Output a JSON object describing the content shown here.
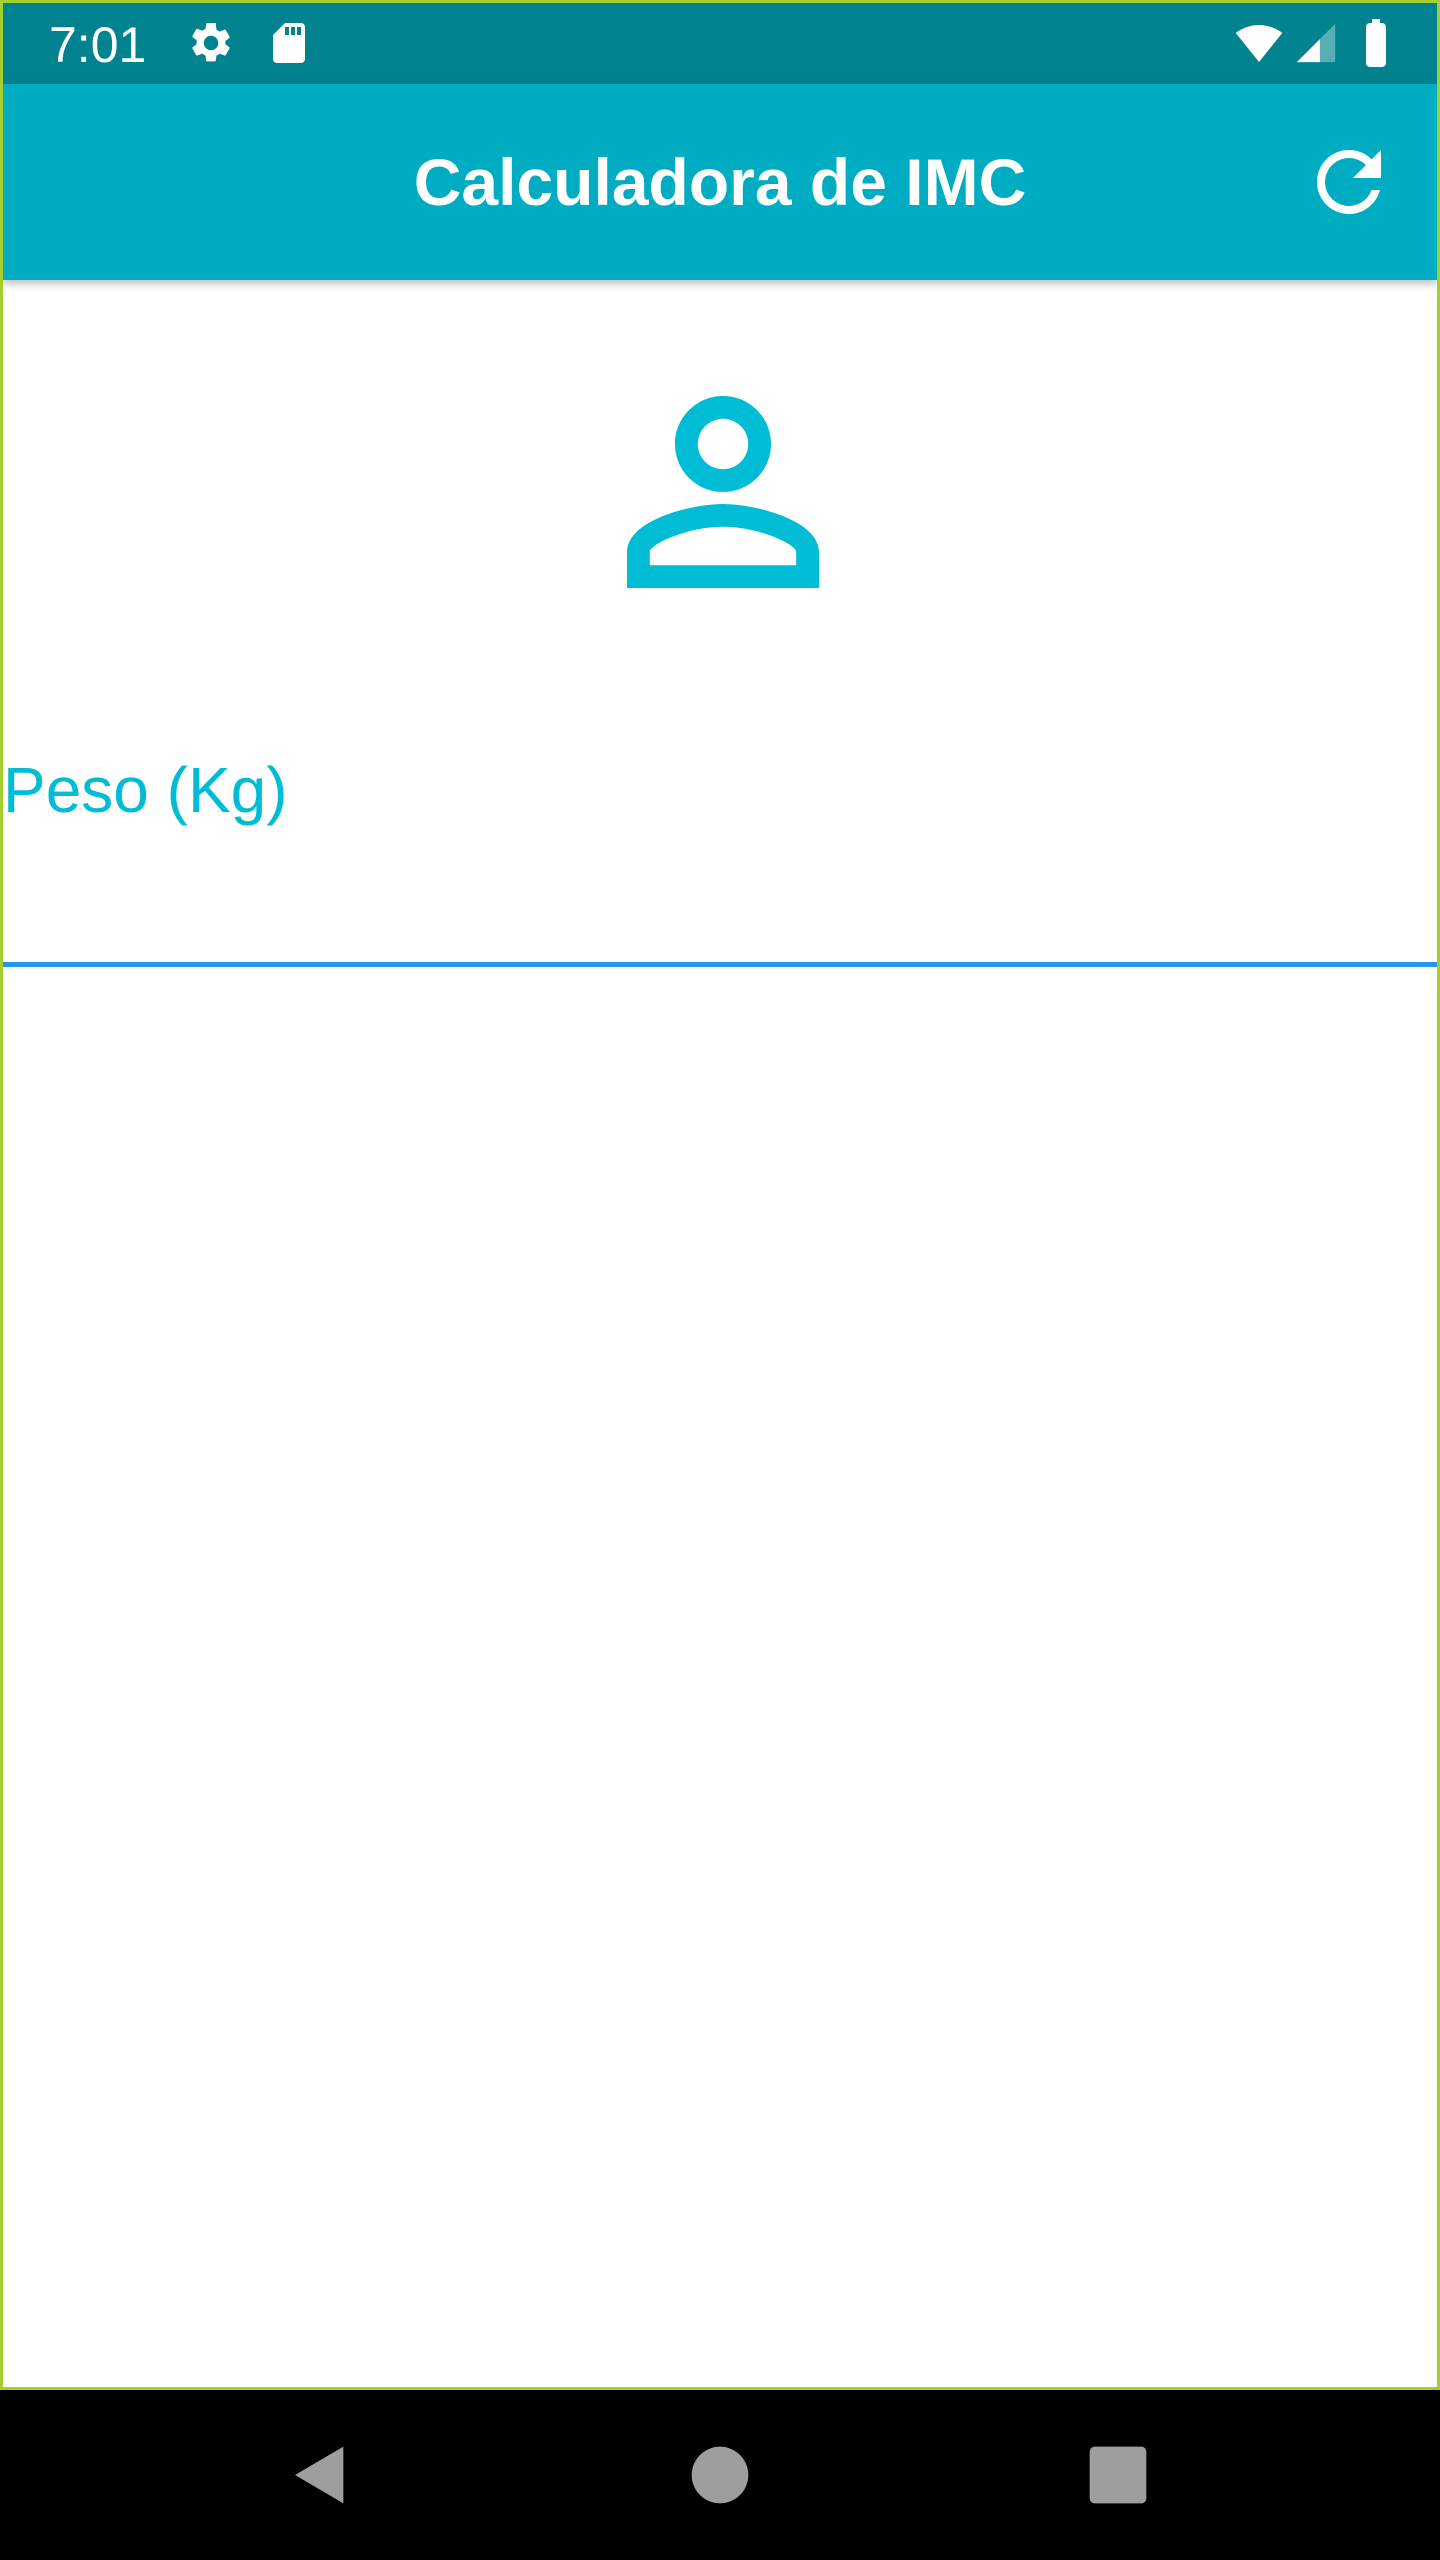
{
  "status_bar": {
    "time": "7:01",
    "icons": [
      "settings-icon",
      "sd-card-icon",
      "wifi-icon",
      "cell-signal-icon",
      "battery-icon"
    ]
  },
  "app_bar": {
    "title": "Calculadora de IMC",
    "action_icon": "refresh-icon"
  },
  "main": {
    "header_icon": "person-outline-icon",
    "weight_field": {
      "label": "Peso (Kg)",
      "value": ""
    }
  },
  "nav_bar": {
    "buttons": [
      "back-icon",
      "home-icon",
      "recents-icon"
    ]
  },
  "colors": {
    "status_bar": "#00838f",
    "app_bar": "#00acc1",
    "accent": "#00bcd4",
    "underline": "#2196f3",
    "frame_border": "#a4cf2c",
    "nav_button": "#9e9e9e"
  }
}
